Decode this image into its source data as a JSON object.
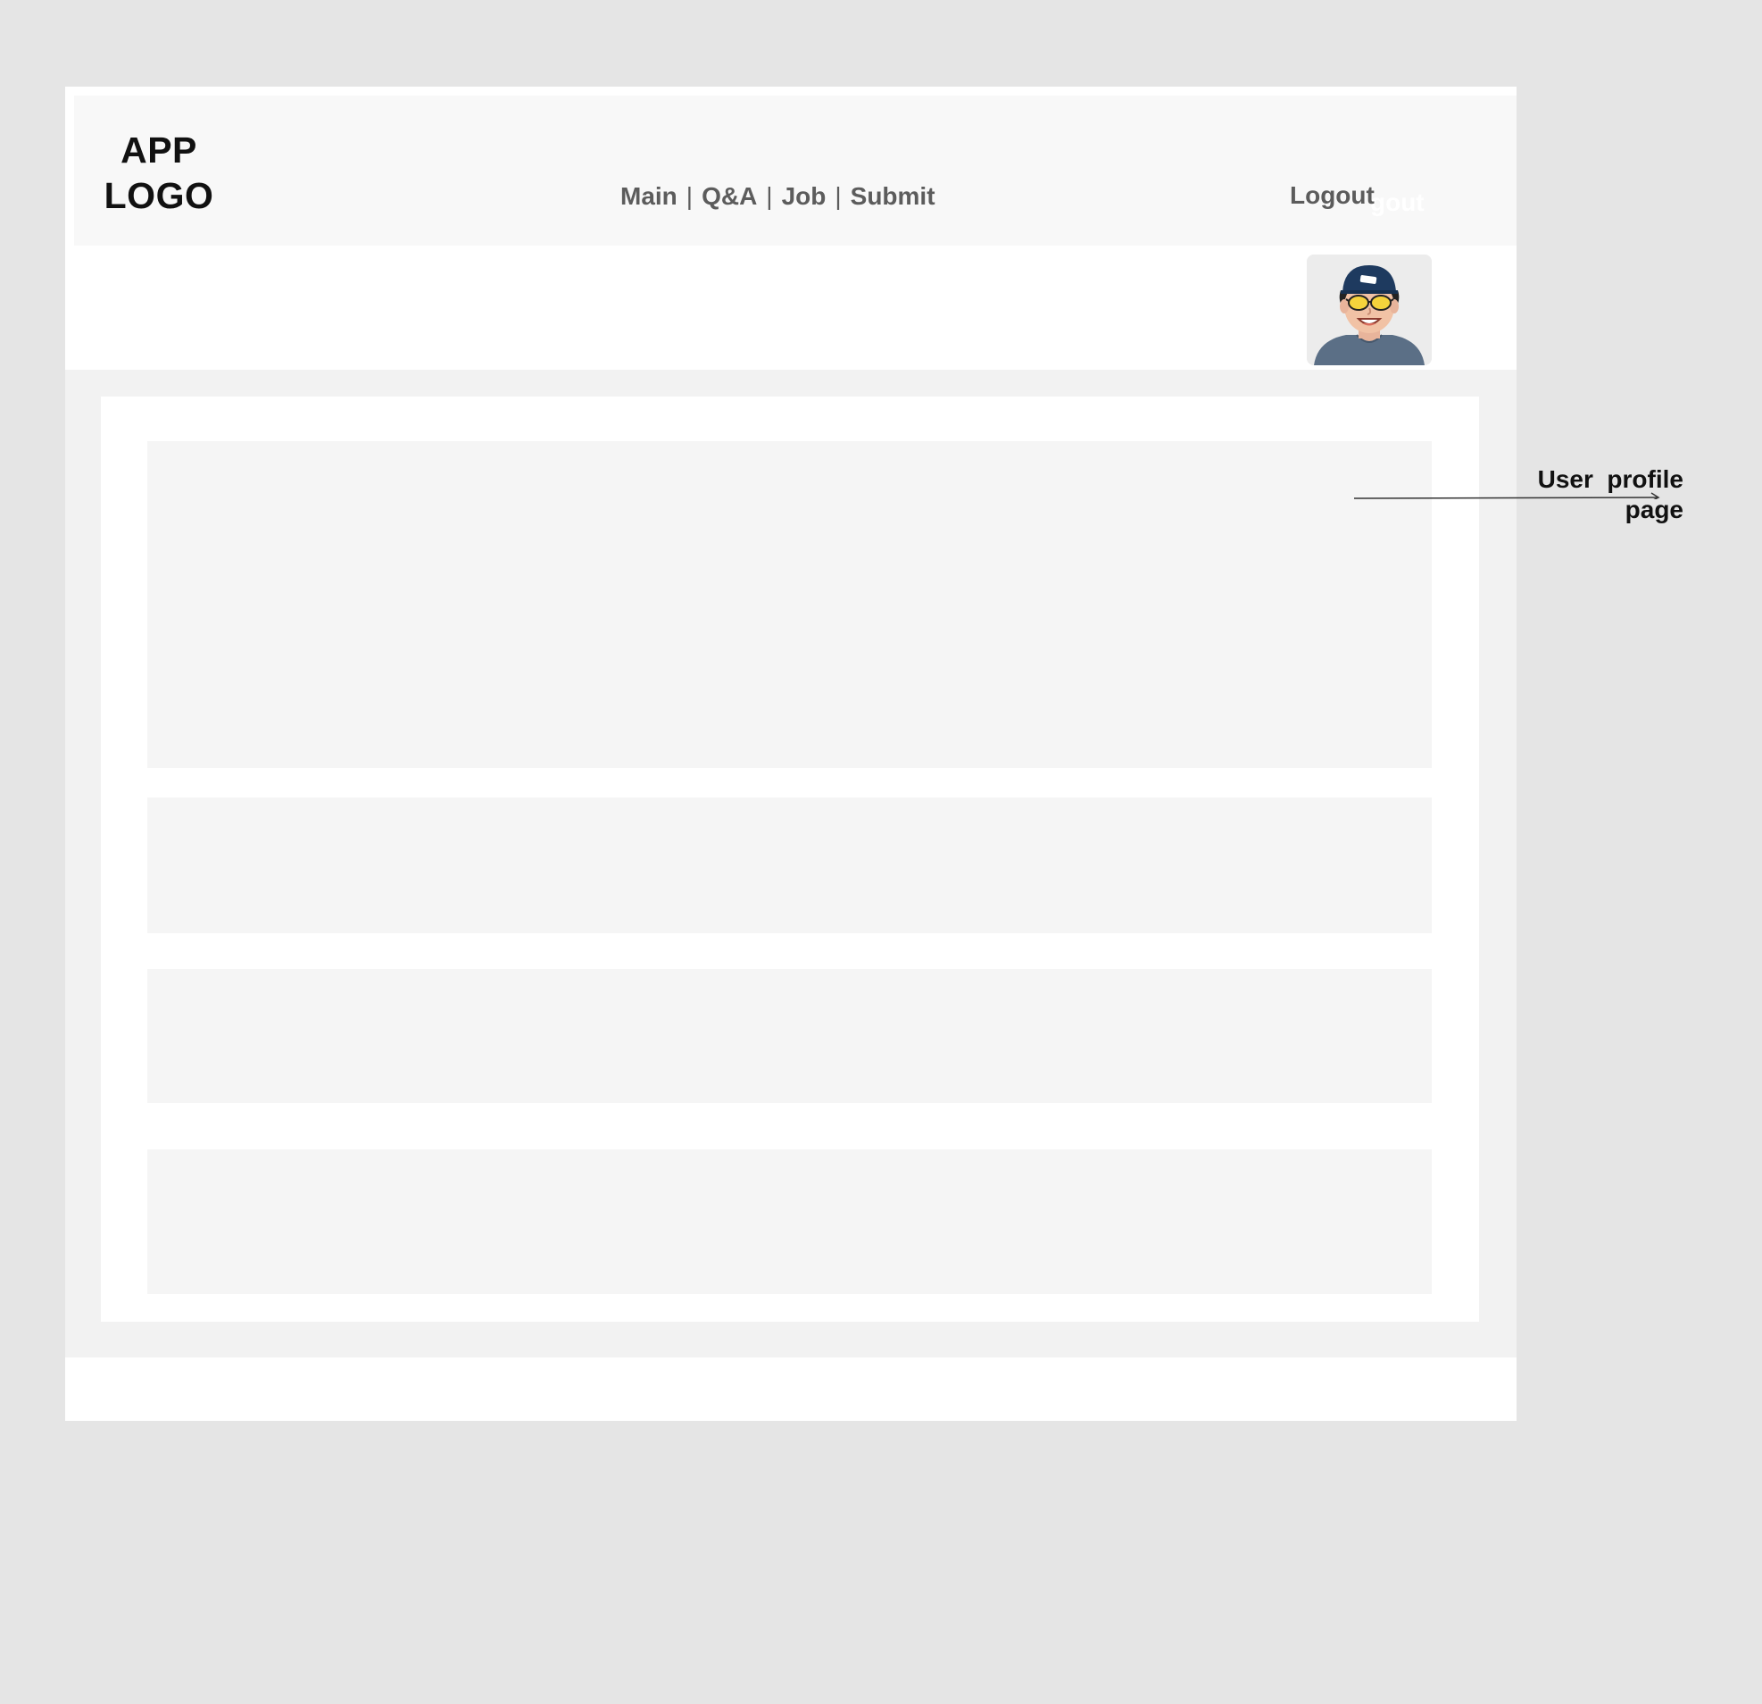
{
  "header": {
    "logo_line1": "APP",
    "logo_line2": "LOGO",
    "nav": {
      "main": "Main",
      "qa": "Q&A",
      "job": "Job",
      "submit": "Submit",
      "separator": "|"
    },
    "logout_label": "Logout",
    "logout_ghost": "gout"
  },
  "avatar": {
    "icon": "user-avatar-cap-sunglasses"
  },
  "annotation": {
    "line1": "User  profile",
    "line2": "page"
  },
  "colors": {
    "page_bg": "#e5e5e5",
    "header_bg": "#f8f8f8",
    "content_bg": "#f2f2f2",
    "panel_bg": "#f5f5f5",
    "nav_text": "#5c5c5c"
  }
}
